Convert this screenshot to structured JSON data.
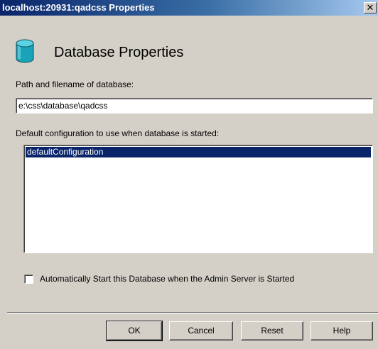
{
  "window": {
    "title": "localhost:20931:qadcss Properties",
    "close_glyph": "✕",
    "close_icon": "close-icon"
  },
  "header": {
    "icon": "database-icon",
    "title": "Database Properties"
  },
  "path": {
    "label": "Path and filename of database:",
    "value": "e:\\css\\database\\qadcss"
  },
  "config": {
    "label": "Default configuration to use when database is started:",
    "items": [
      "defaultConfiguration"
    ],
    "selected_index": 0
  },
  "autostart": {
    "label": "Automatically Start this Database when the Admin Server is Started",
    "checked": false
  },
  "buttons": {
    "ok": "OK",
    "cancel": "Cancel",
    "reset": "Reset",
    "help": "Help"
  },
  "colors": {
    "titlebar_start": "#0a246a",
    "titlebar_end": "#a6caf0",
    "selection": "#0a246a",
    "face": "#d4d0c8",
    "db_icon": "#1aa3b8"
  }
}
